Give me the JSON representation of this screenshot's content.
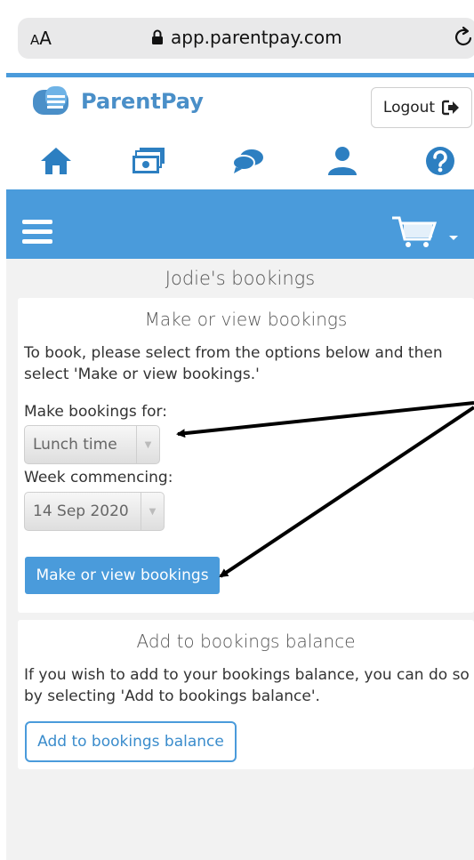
{
  "browser": {
    "text_size_label": "AA",
    "url": "app.parentpay.com"
  },
  "header": {
    "brand": "ParentPay",
    "logout_label": "Logout"
  },
  "nav_icons": [
    "home-icon",
    "payments-icon",
    "messages-icon",
    "profile-icon",
    "help-icon"
  ],
  "page_title": "Jodie's bookings",
  "bookings_card": {
    "title": "Make or view bookings",
    "description": "To book, please select from the options below and then select 'Make or view bookings.'",
    "make_for_label": "Make bookings for:",
    "make_for_value": "Lunch time",
    "week_label": "Week commencing:",
    "week_value": "14 Sep 2020",
    "button_label": "Make or view bookings"
  },
  "balance_card": {
    "title": "Add to bookings balance",
    "description": "If you wish to add to your bookings balance, you can do so by selecting 'Add to bookings balance'.",
    "button_label": "Add to bookings balance"
  },
  "colors": {
    "brand_blue": "#4a9bdb",
    "page_bg": "#f2f2f2"
  }
}
